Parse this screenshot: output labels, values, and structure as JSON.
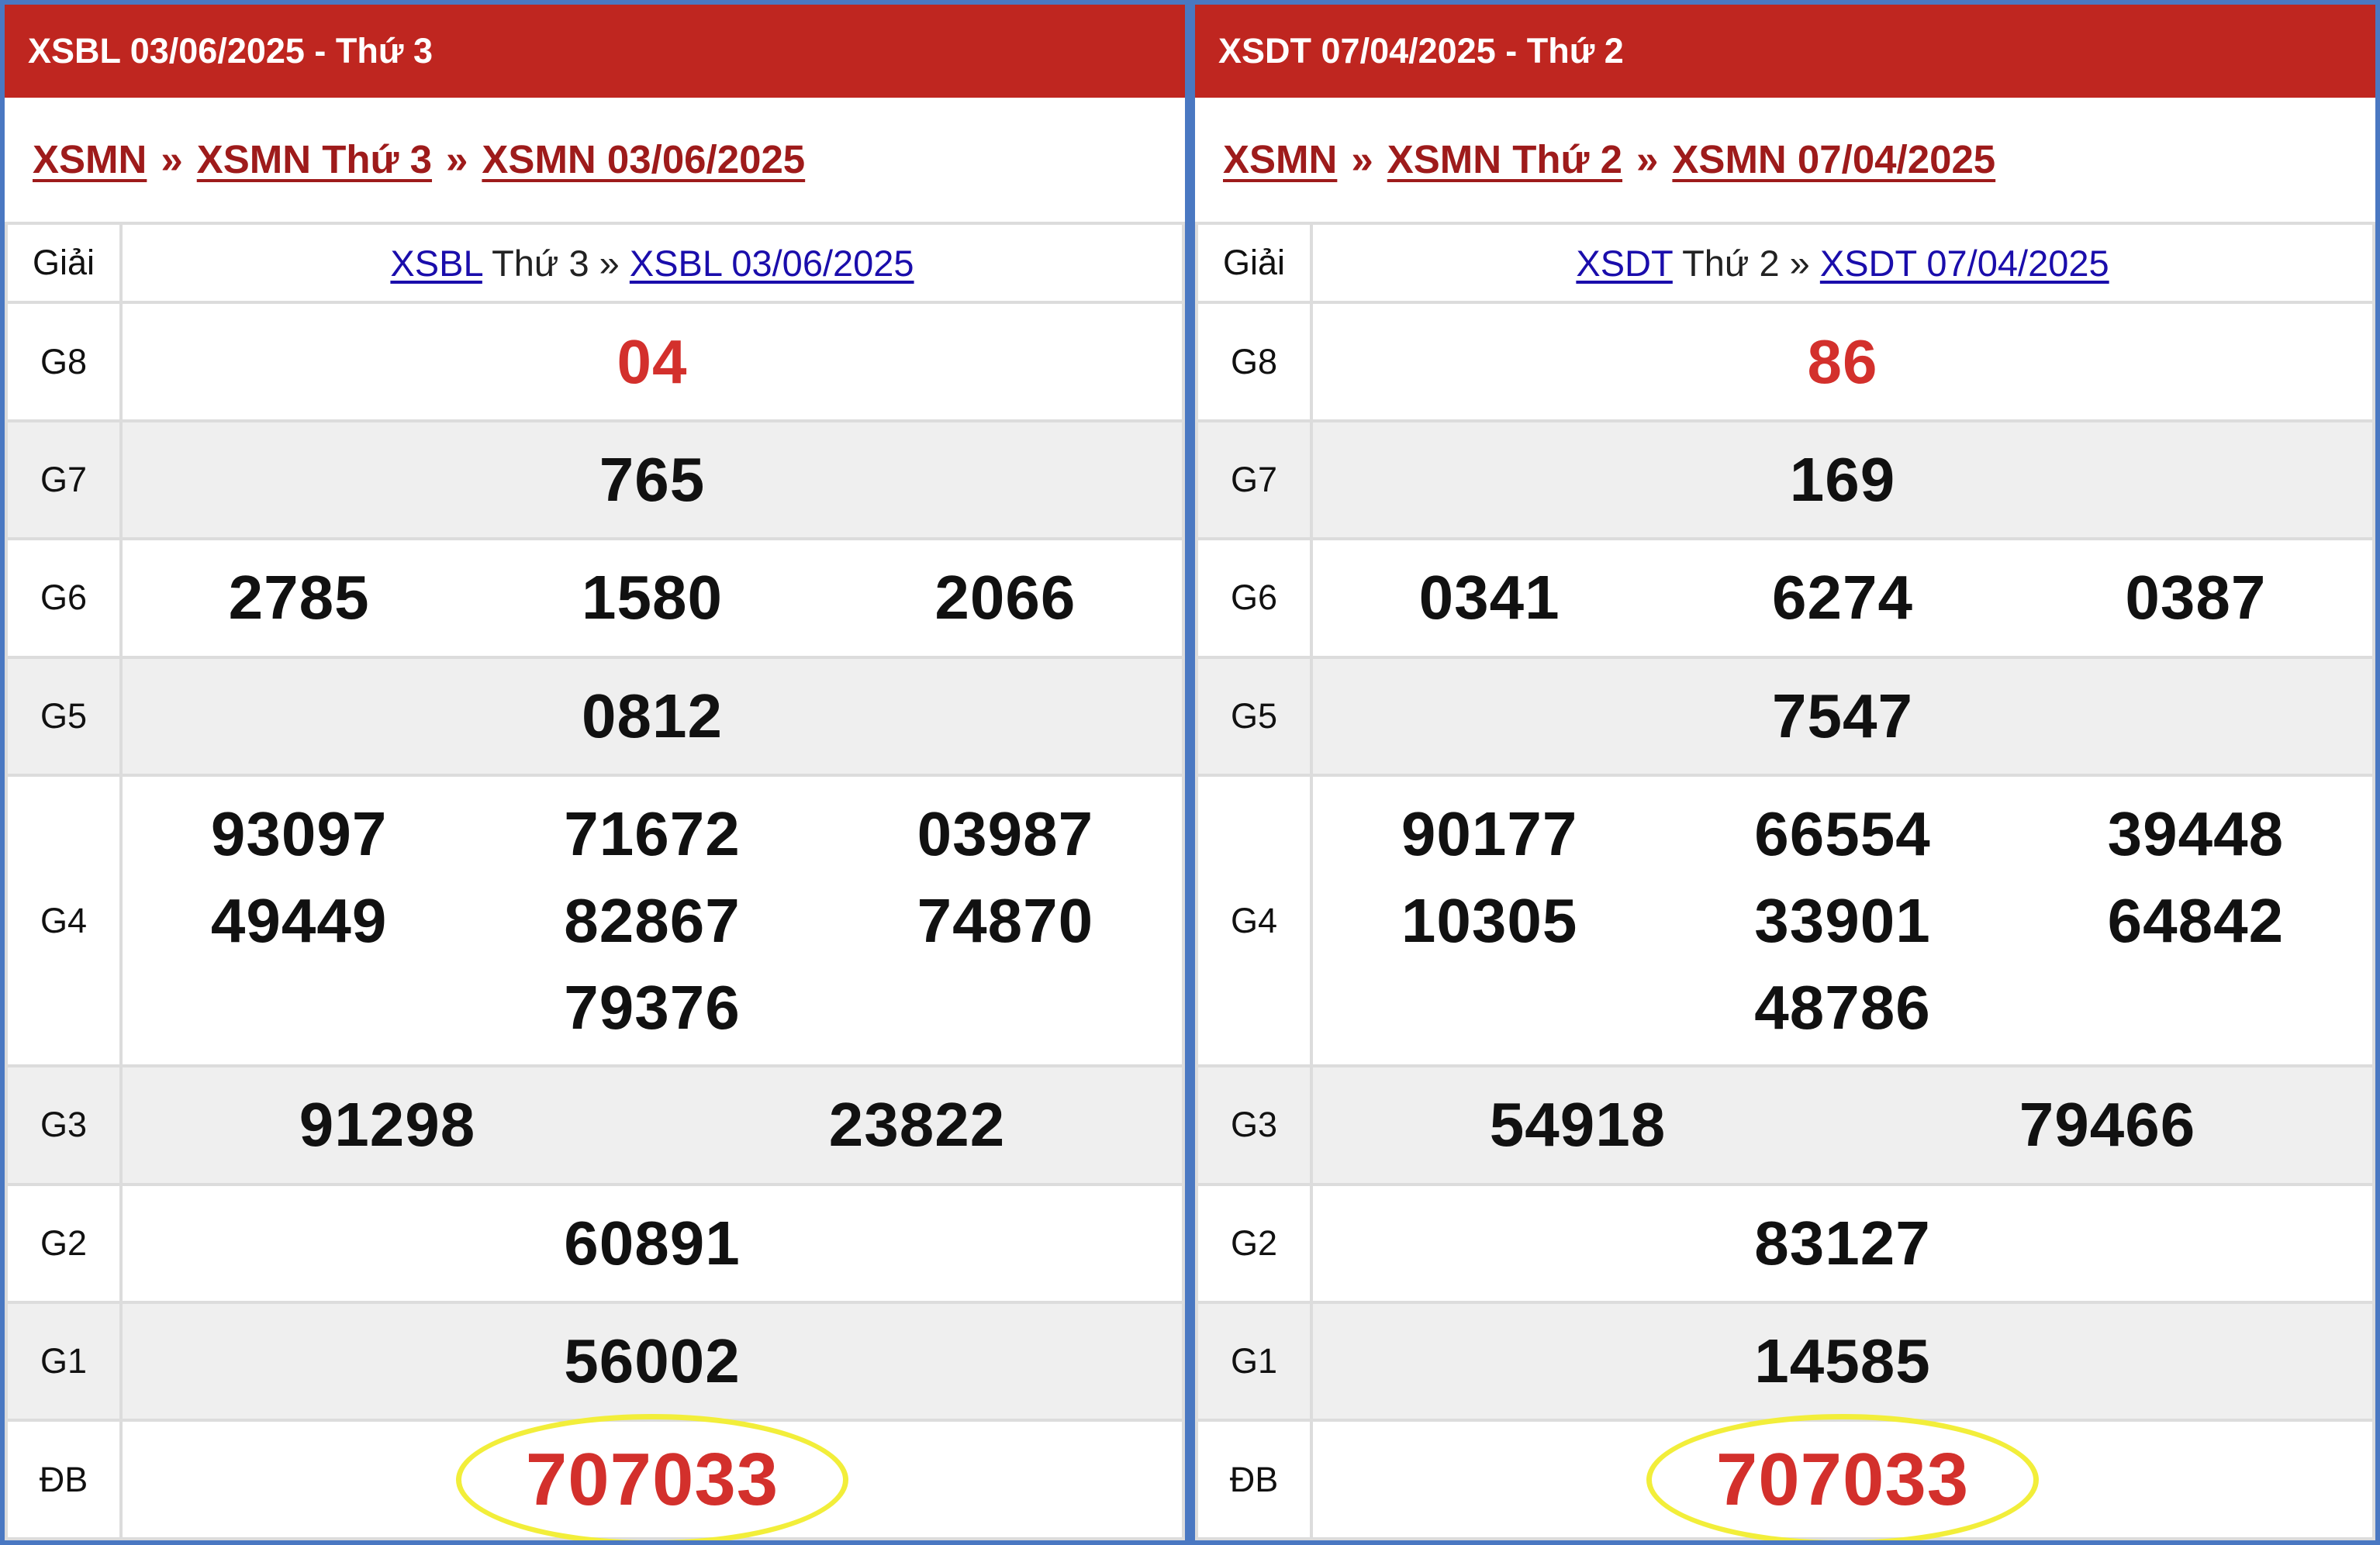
{
  "panels": [
    {
      "header": "XSBL 03/06/2025 - Thứ 3",
      "breadcrumb": [
        "XSMN",
        "XSMN Thứ 3",
        "XSMN 03/06/2025"
      ],
      "separator": "»",
      "table_header": {
        "label": "Giải",
        "link1": "XSBL",
        "text": " Thứ 3 » ",
        "link2": "XSBL 03/06/2025"
      },
      "labels": {
        "g8": "G8",
        "g7": "G7",
        "g6": "G6",
        "g5": "G5",
        "g4": "G4",
        "g3": "G3",
        "g2": "G2",
        "g1": "G1",
        "db": "ĐB"
      },
      "g8": "04",
      "g7": "765",
      "g6": [
        "2785",
        "1580",
        "2066"
      ],
      "g5": "0812",
      "g4": [
        [
          "93097",
          "49449"
        ],
        [
          "71672",
          "82867",
          "79376"
        ],
        [
          "03987",
          "74870"
        ]
      ],
      "g3": [
        "91298",
        "23822"
      ],
      "g2": "60891",
      "g1": "56002",
      "db": "707033"
    },
    {
      "header": "XSDT 07/04/2025 - Thứ 2",
      "breadcrumb": [
        "XSMN",
        "XSMN Thứ 2",
        "XSMN 07/04/2025"
      ],
      "separator": "»",
      "table_header": {
        "label": "Giải",
        "link1": "XSDT",
        "text": " Thứ 2 » ",
        "link2": "XSDT 07/04/2025"
      },
      "labels": {
        "g8": "G8",
        "g7": "G7",
        "g6": "G6",
        "g5": "G5",
        "g4": "G4",
        "g3": "G3",
        "g2": "G2",
        "g1": "G1",
        "db": "ĐB"
      },
      "g8": "86",
      "g7": "169",
      "g6": [
        "0341",
        "6274",
        "0387"
      ],
      "g5": "7547",
      "g4": [
        [
          "90177",
          "10305"
        ],
        [
          "66554",
          "33901",
          "48786"
        ],
        [
          "39448",
          "64842"
        ]
      ],
      "g3": [
        "54918",
        "79466"
      ],
      "g2": "83127",
      "g1": "14585",
      "db": "707033"
    }
  ],
  "colors": {
    "header_bg": "#bf2620",
    "link_dark_red": "#9e1b1b",
    "link_blue": "#1a0dab",
    "special_red": "#d3302c",
    "highlight_circle": "#f2ee3a",
    "border": "#4a78c2"
  }
}
